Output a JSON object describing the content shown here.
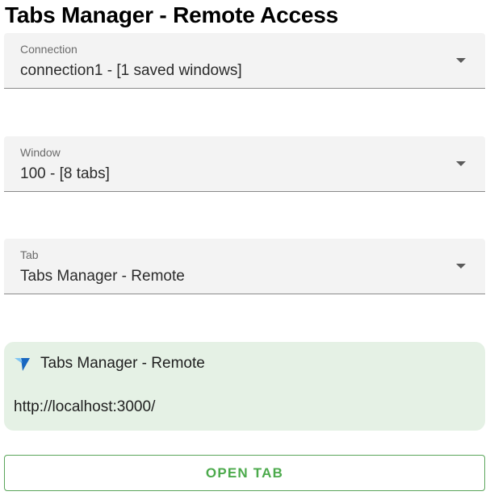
{
  "app": {
    "title": "Tabs Manager - Remote Access"
  },
  "connection": {
    "label": "Connection",
    "value": "connection1 - [1 saved windows]"
  },
  "window": {
    "label": "Window",
    "value": "100 - [8 tabs]"
  },
  "tab": {
    "label": "Tab",
    "value": "Tabs Manager - Remote"
  },
  "tab_card": {
    "favicon": "vuetify-logo-icon",
    "title": "Tabs Manager - Remote",
    "url": "http://localhost:3000/",
    "background_color": "#e5f1e5"
  },
  "actions": {
    "open_tab_label": "OPEN TAB",
    "accent_color": "#4caa4c"
  },
  "icons": {
    "dropdown": "chevron-down-icon"
  }
}
